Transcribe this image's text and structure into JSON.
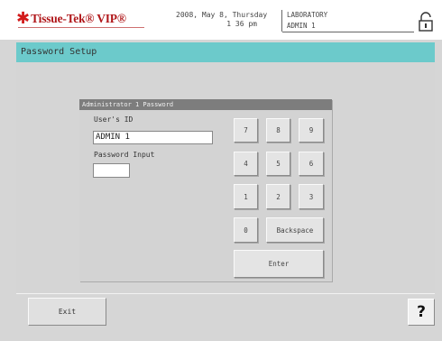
{
  "header": {
    "logo_text": "Tissue-Tek® VIP®",
    "date": "2008, May 8, Thursday",
    "time": "1 36 pm",
    "station": "LABORATORY",
    "user": "ADMIN 1",
    "lock_icon": "padlock-unlocked-icon"
  },
  "screen": {
    "title": "Password Setup"
  },
  "dialog": {
    "title": "Administrator 1 Password",
    "user_id_label": "User's ID",
    "user_id_value": "ADMIN 1",
    "password_label": "Password Input",
    "password_value": ""
  },
  "keypad": {
    "k7": "7",
    "k8": "8",
    "k9": "9",
    "k4": "4",
    "k5": "5",
    "k6": "6",
    "k1": "1",
    "k2": "2",
    "k3": "3",
    "k0": "0",
    "backspace": "Backspace",
    "enter": "Enter"
  },
  "footer": {
    "exit": "Exit",
    "help": "?"
  },
  "colors": {
    "title_bar": "#6ccacb",
    "logo_red": "#b0171a",
    "dialog_title_bg": "#7d7d7d"
  }
}
